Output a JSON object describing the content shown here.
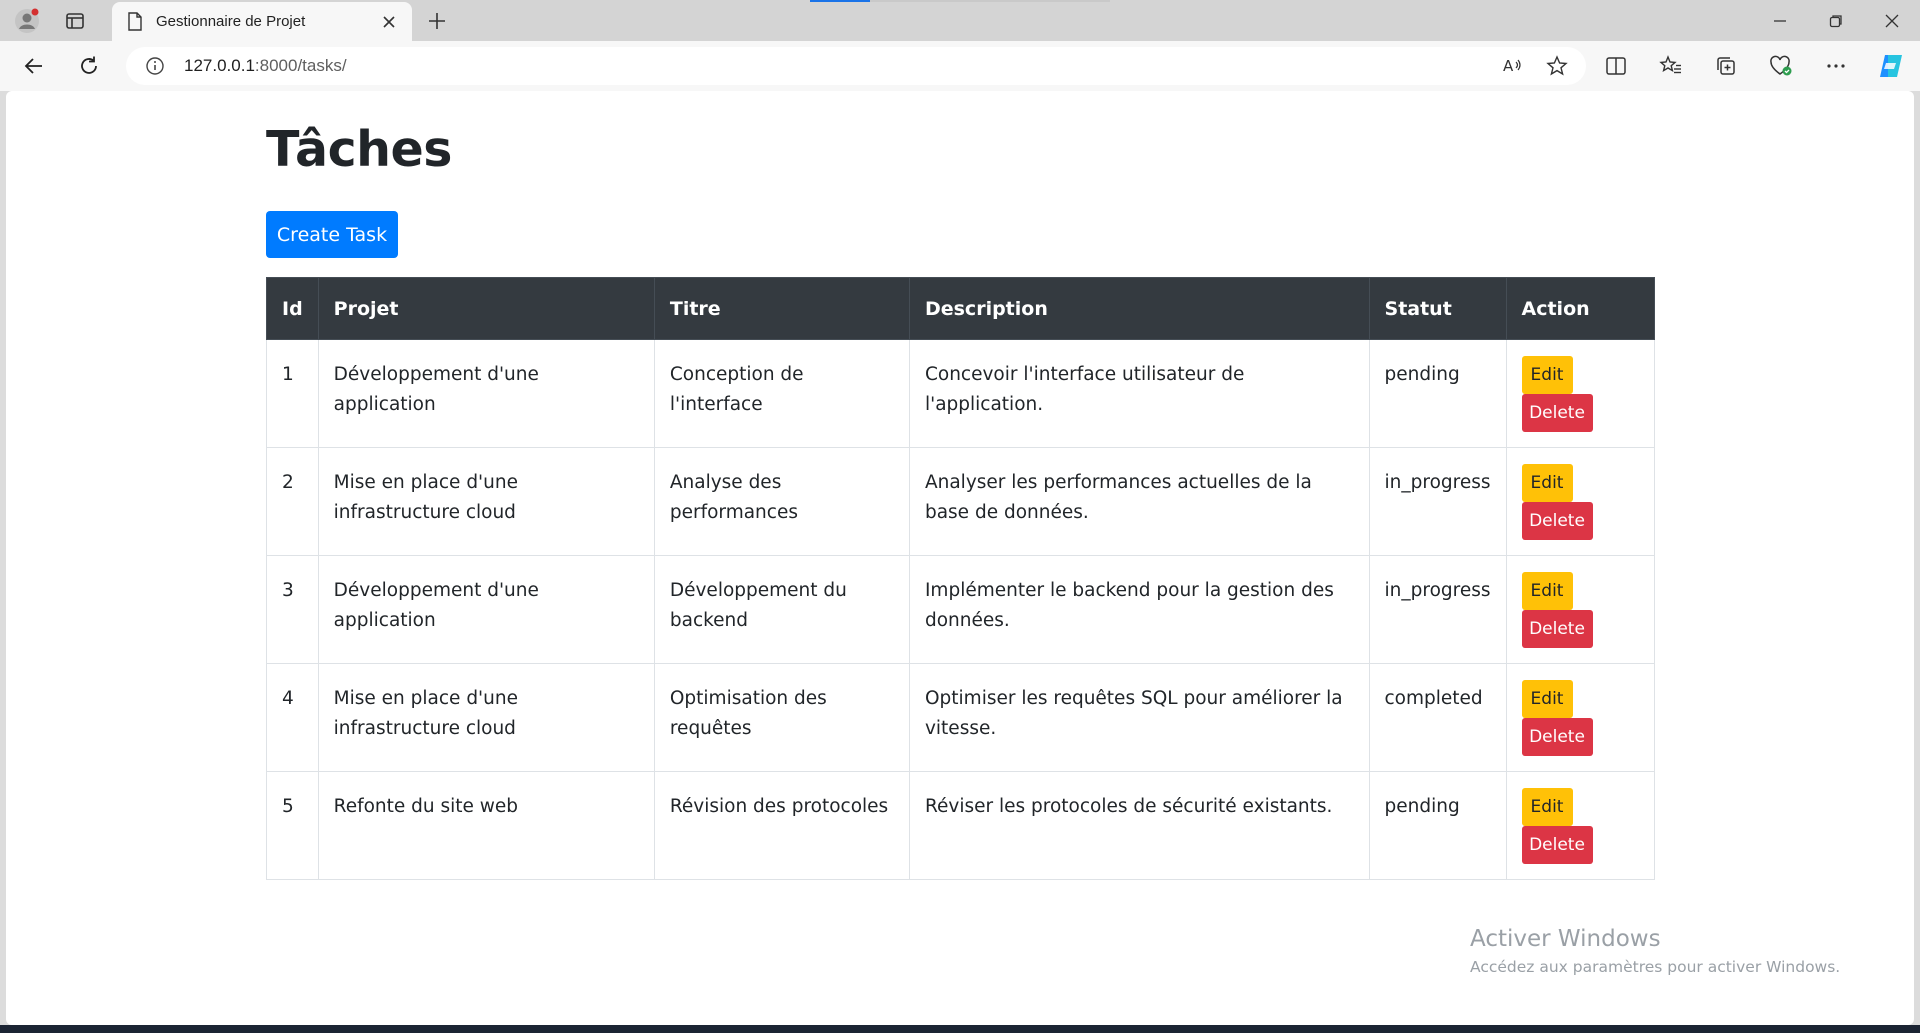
{
  "browser": {
    "tab_title": "Gestionnaire de Projet",
    "url_host": "127.0.0.1",
    "url_path": ":8000/tasks/"
  },
  "page": {
    "title": "Tâches",
    "create_button": "Create Task"
  },
  "table": {
    "headers": [
      "Id",
      "Projet",
      "Titre",
      "Description",
      "Statut",
      "Action"
    ],
    "rows": [
      {
        "id": "1",
        "projet": "Développement d'une application",
        "titre": "Conception de l'interface",
        "description": "Concevoir l'interface utilisateur de l'application.",
        "statut": "pending",
        "edit": "Edit",
        "delete": "Delete"
      },
      {
        "id": "2",
        "projet": "Mise en place d'une infrastructure cloud",
        "titre": "Analyse des performances",
        "description": "Analyser les performances actuelles de la base de données.",
        "statut": "in_progress",
        "edit": "Edit",
        "delete": "Delete"
      },
      {
        "id": "3",
        "projet": "Développement d'une application",
        "titre": "Développement du backend",
        "description": "Implémenter le backend pour la gestion des données.",
        "statut": "in_progress",
        "edit": "Edit",
        "delete": "Delete"
      },
      {
        "id": "4",
        "projet": "Mise en place d'une infrastructure cloud",
        "titre": "Optimisation des requêtes",
        "description": "Optimiser les requêtes SQL pour améliorer la vitesse.",
        "statut": "completed",
        "edit": "Edit",
        "delete": "Delete"
      },
      {
        "id": "5",
        "projet": "Refonte du site web",
        "titre": "Révision des protocoles",
        "description": "Réviser les protocoles de sécurité existants.",
        "statut": "pending",
        "edit": "Edit",
        "delete": "Delete"
      }
    ]
  },
  "watermark": {
    "line1": "Activer Windows",
    "line2": "Accédez aux paramètres pour activer Windows."
  },
  "colors": {
    "primary": "#007bff",
    "warning": "#ffc107",
    "danger": "#dc3545",
    "table_head": "#343a40"
  }
}
